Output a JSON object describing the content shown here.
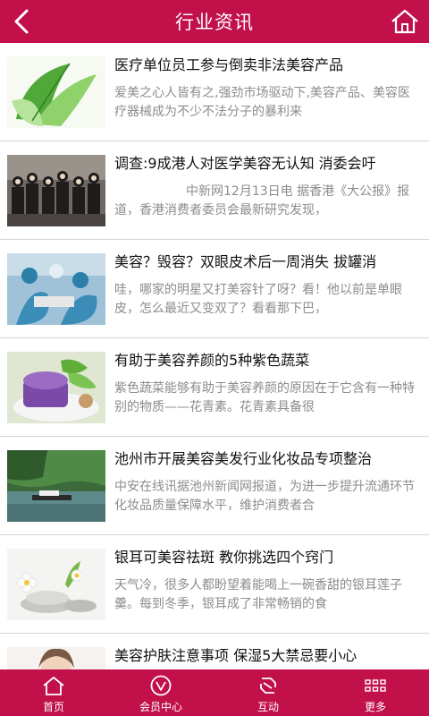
{
  "header": {
    "title": "行业资讯",
    "back_icon": "back-arrow-icon",
    "home_icon": "home-icon",
    "accent_color": "#c1104a"
  },
  "articles": [
    {
      "title": "医疗单位员工参与倒卖非法美容产品",
      "summary": "爱美之心人皆有之,强劲市场驱动下,美容产品、美容医疗器械成为不少不法分子的暴利来",
      "image": "green-leaves-cosmetic-photo"
    },
    {
      "title": "调查:9成港人对医学美容无认知 消委会吁",
      "summary": "中新网12月13日电 据香港《大公报》报道，香港消费者委员会最新研究发现，",
      "image": "group-of-people-photo"
    },
    {
      "title": "美容？毁容？双眼皮术后一周消失 拔罐消",
      "summary": "哇，哪家的明星又打美容针了呀？看！他以前是单眼皮，怎么最近又变双了？看看那下巴，",
      "image": "surgery-room-photo"
    },
    {
      "title": "有助于美容养颜的5种紫色蔬菜",
      "summary": "紫色蔬菜能够有助于美容养颜的原因在于它含有一种特别的物质——花青素。花青素具备很",
      "image": "purple-dessert-photo"
    },
    {
      "title": "池州市开展美容美发行业化妆品专项整治",
      "summary": "中安在线讯据池州新闻网报道，为进一步提升流通环节化妆品质量保障水平，维护消费者合",
      "image": "river-boat-photo"
    },
    {
      "title": "银耳可美容祛斑 教你挑选四个窍门",
      "summary": "天气冷，很多人都盼望着能喝上一碗香甜的银耳莲子羹。每到冬季，银耳成了非常畅销的食",
      "image": "spa-stones-flower-photo"
    },
    {
      "title": "美容护肤注意事项 保湿5大禁忌要小心",
      "summary": "",
      "image": "woman-face-photo"
    }
  ],
  "tabs": [
    {
      "label": "首页",
      "icon": "home-icon"
    },
    {
      "label": "会员中心",
      "icon": "member-v-icon"
    },
    {
      "label": "互动",
      "icon": "interaction-icon"
    },
    {
      "label": "更多",
      "icon": "more-grid-icon"
    }
  ]
}
